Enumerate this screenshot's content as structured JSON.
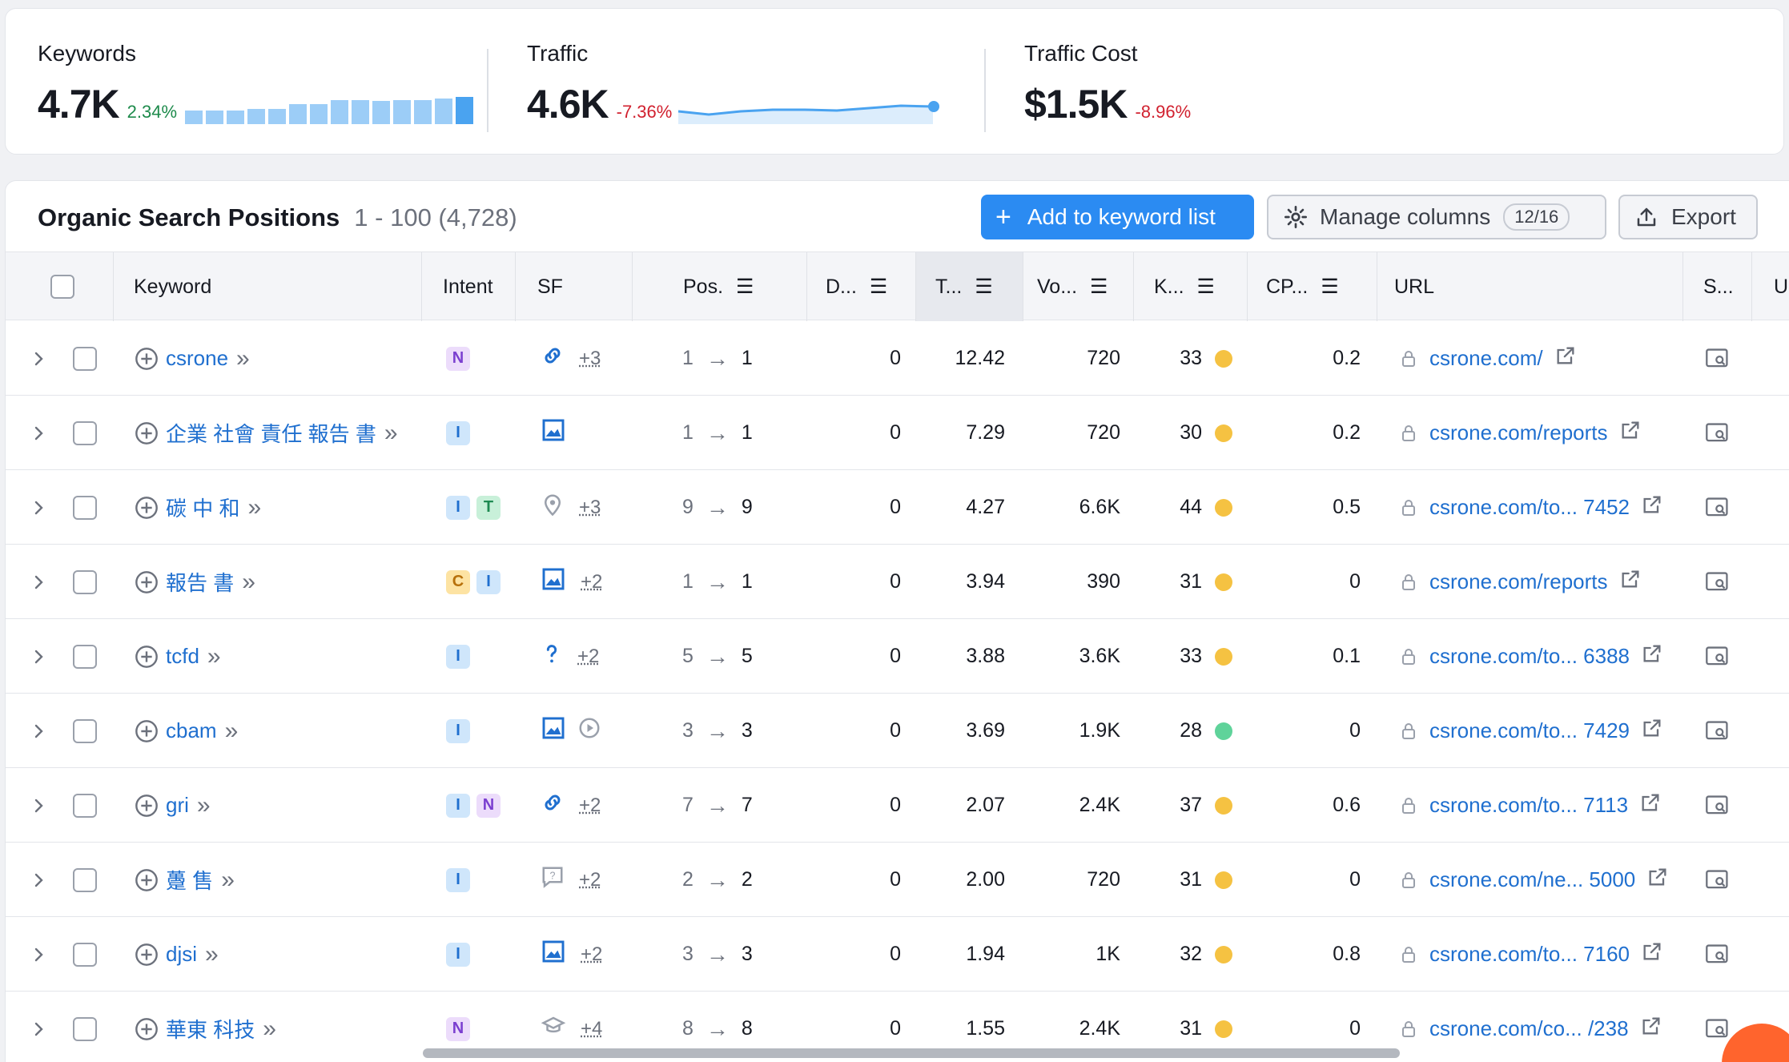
{
  "summary": {
    "keywords": {
      "label": "Keywords",
      "value": "4.7K",
      "delta": "2.34%"
    },
    "traffic": {
      "label": "Traffic",
      "value": "4.6K",
      "delta": "-7.36%"
    },
    "traffic_cost": {
      "label": "Traffic Cost",
      "value": "$1.5K",
      "delta": "-8.96%"
    },
    "keywords_trend_bars": [
      0.45,
      0.45,
      0.45,
      0.5,
      0.5,
      0.65,
      0.65,
      0.8,
      0.8,
      0.75,
      0.8,
      0.8,
      0.85,
      0.9
    ],
    "colors": {
      "positive": "#1d8a4b",
      "negative": "#d1212f",
      "accent": "#2b8bf2"
    }
  },
  "table": {
    "title": "Organic Search Positions",
    "count": "1 - 100 (4,728)",
    "add_button": "Add to keyword list",
    "manage_button": "Manage columns",
    "manage_count": "12/16",
    "export_button": "Export",
    "headers": {
      "keyword": "Keyword",
      "intent": "Intent",
      "sf": "SF",
      "pos": "Pos.",
      "d": "D...",
      "t": "T...",
      "vo": "Vo...",
      "k": "K...",
      "cp": "CP...",
      "url": "URL",
      "s": "S...",
      "u": "U"
    },
    "rows": [
      {
        "keyword": "csrone",
        "intents": [
          "N"
        ],
        "sf_icon": "link-icon",
        "sf_more": "+3",
        "pos_from": "1",
        "pos_to": "1",
        "d": "0",
        "t": "12.42",
        "vo": "720",
        "k": "33",
        "k_color": "#f5c242",
        "cp": "0.2",
        "url": "csrone.com/"
      },
      {
        "keyword": "企業 社會 責任 報告 書",
        "intents": [
          "I"
        ],
        "sf_icon": "image-icon",
        "sf_more": "",
        "pos_from": "1",
        "pos_to": "1",
        "d": "0",
        "t": "7.29",
        "vo": "720",
        "k": "30",
        "k_color": "#f5c242",
        "cp": "0.2",
        "url": "csrone.com/reports"
      },
      {
        "keyword": "碳 中 和",
        "intents": [
          "I",
          "T"
        ],
        "sf_icon": "location-icon",
        "sf_more": "+3",
        "pos_from": "9",
        "pos_to": "9",
        "d": "0",
        "t": "4.27",
        "vo": "6.6K",
        "k": "44",
        "k_color": "#f5c242",
        "cp": "0.5",
        "url": "csrone.com/to... 7452"
      },
      {
        "keyword": "報告 書",
        "intents": [
          "C",
          "I"
        ],
        "sf_icon": "image-icon",
        "sf_more": "+2",
        "pos_from": "1",
        "pos_to": "1",
        "d": "0",
        "t": "3.94",
        "vo": "390",
        "k": "31",
        "k_color": "#f5c242",
        "cp": "0",
        "url": "csrone.com/reports"
      },
      {
        "keyword": "tcfd",
        "intents": [
          "I"
        ],
        "sf_icon": "question-icon",
        "sf_more": "+2",
        "pos_from": "5",
        "pos_to": "5",
        "d": "0",
        "t": "3.88",
        "vo": "3.6K",
        "k": "33",
        "k_color": "#f5c242",
        "cp": "0.1",
        "url": "csrone.com/to... 6388"
      },
      {
        "keyword": "cbam",
        "intents": [
          "I"
        ],
        "sf_icon": "image-icon",
        "sf_icon2": "video-icon",
        "sf_more": "",
        "pos_from": "3",
        "pos_to": "3",
        "d": "0",
        "t": "3.69",
        "vo": "1.9K",
        "k": "28",
        "k_color": "#5fd39a",
        "cp": "0",
        "url": "csrone.com/to... 7429"
      },
      {
        "keyword": "gri",
        "intents": [
          "I",
          "N"
        ],
        "sf_icon": "link-icon",
        "sf_more": "+2",
        "pos_from": "7",
        "pos_to": "7",
        "d": "0",
        "t": "2.07",
        "vo": "2.4K",
        "k": "37",
        "k_color": "#f5c242",
        "cp": "0.6",
        "url": "csrone.com/to... 7113"
      },
      {
        "keyword": "躉 售",
        "intents": [
          "I"
        ],
        "sf_icon": "faq-icon",
        "sf_more": "+2",
        "pos_from": "2",
        "pos_to": "2",
        "d": "0",
        "t": "2.00",
        "vo": "720",
        "k": "31",
        "k_color": "#f5c242",
        "cp": "0",
        "url": "csrone.com/ne... 5000"
      },
      {
        "keyword": "djsi",
        "intents": [
          "I"
        ],
        "sf_icon": "image-icon",
        "sf_more": "+2",
        "pos_from": "3",
        "pos_to": "3",
        "d": "0",
        "t": "1.94",
        "vo": "1K",
        "k": "32",
        "k_color": "#f5c242",
        "cp": "0.8",
        "url": "csrone.com/to... 7160"
      },
      {
        "keyword": "華東 科技",
        "intents": [
          "N"
        ],
        "sf_icon": "education-icon",
        "sf_more": "+4",
        "pos_from": "8",
        "pos_to": "8",
        "d": "0",
        "t": "1.55",
        "vo": "2.4K",
        "k": "31",
        "k_color": "#f5c242",
        "cp": "0",
        "url": "csrone.com/co... /238"
      }
    ]
  }
}
